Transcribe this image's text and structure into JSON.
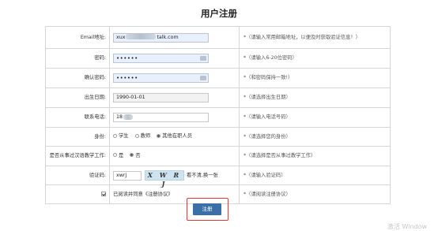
{
  "page": {
    "title": "用户注册",
    "submit_label": "注册",
    "watermark": "激活 Window"
  },
  "form": {
    "email": {
      "label": "Email地址:",
      "value_prefix": "xux",
      "value_suffix": "talk.com",
      "hint": "*（请输入常用邮箱地址，以便及时获取验证信息！）"
    },
    "password": {
      "label": "密码:",
      "value": "••••••",
      "hint": "*（请输入6-20位密码）"
    },
    "confirm_password": {
      "label": "确认密码:",
      "value": "••••••",
      "hint": "*（和密码保持一致!）"
    },
    "birthdate": {
      "label": "出生日期:",
      "value": "1990-01-01",
      "hint": "*（请选择出生日期）"
    },
    "phone": {
      "label": "联系电话:",
      "value_prefix": "18",
      "hint": "*（请输入电话号码）"
    },
    "identity": {
      "label": "身份:",
      "options": [
        "学生",
        "教师",
        "其他在职人员"
      ],
      "selected": "其他在职人员",
      "hint": "*（请选择您的身份）"
    },
    "teaching": {
      "label": "是否从事过汉语教学工作:",
      "options": [
        "是",
        "否"
      ],
      "selected": "否",
      "hint": "*（请选择是否从事过教学工作）"
    },
    "captcha": {
      "label": "验证码:",
      "value": "xwrj",
      "image_text": "X W R J",
      "refresh_label": "看不清,换一张",
      "hint": "*（请输入验证码）"
    },
    "agreement": {
      "label": "已阅读并同意《注册协议》",
      "checked": true,
      "hint": "*（请阅读注册协议）"
    }
  },
  "colors": {
    "submit_button": "#3b6fa8",
    "highlight_border": "#e53935",
    "input_autofill": "#e8f0fd"
  }
}
